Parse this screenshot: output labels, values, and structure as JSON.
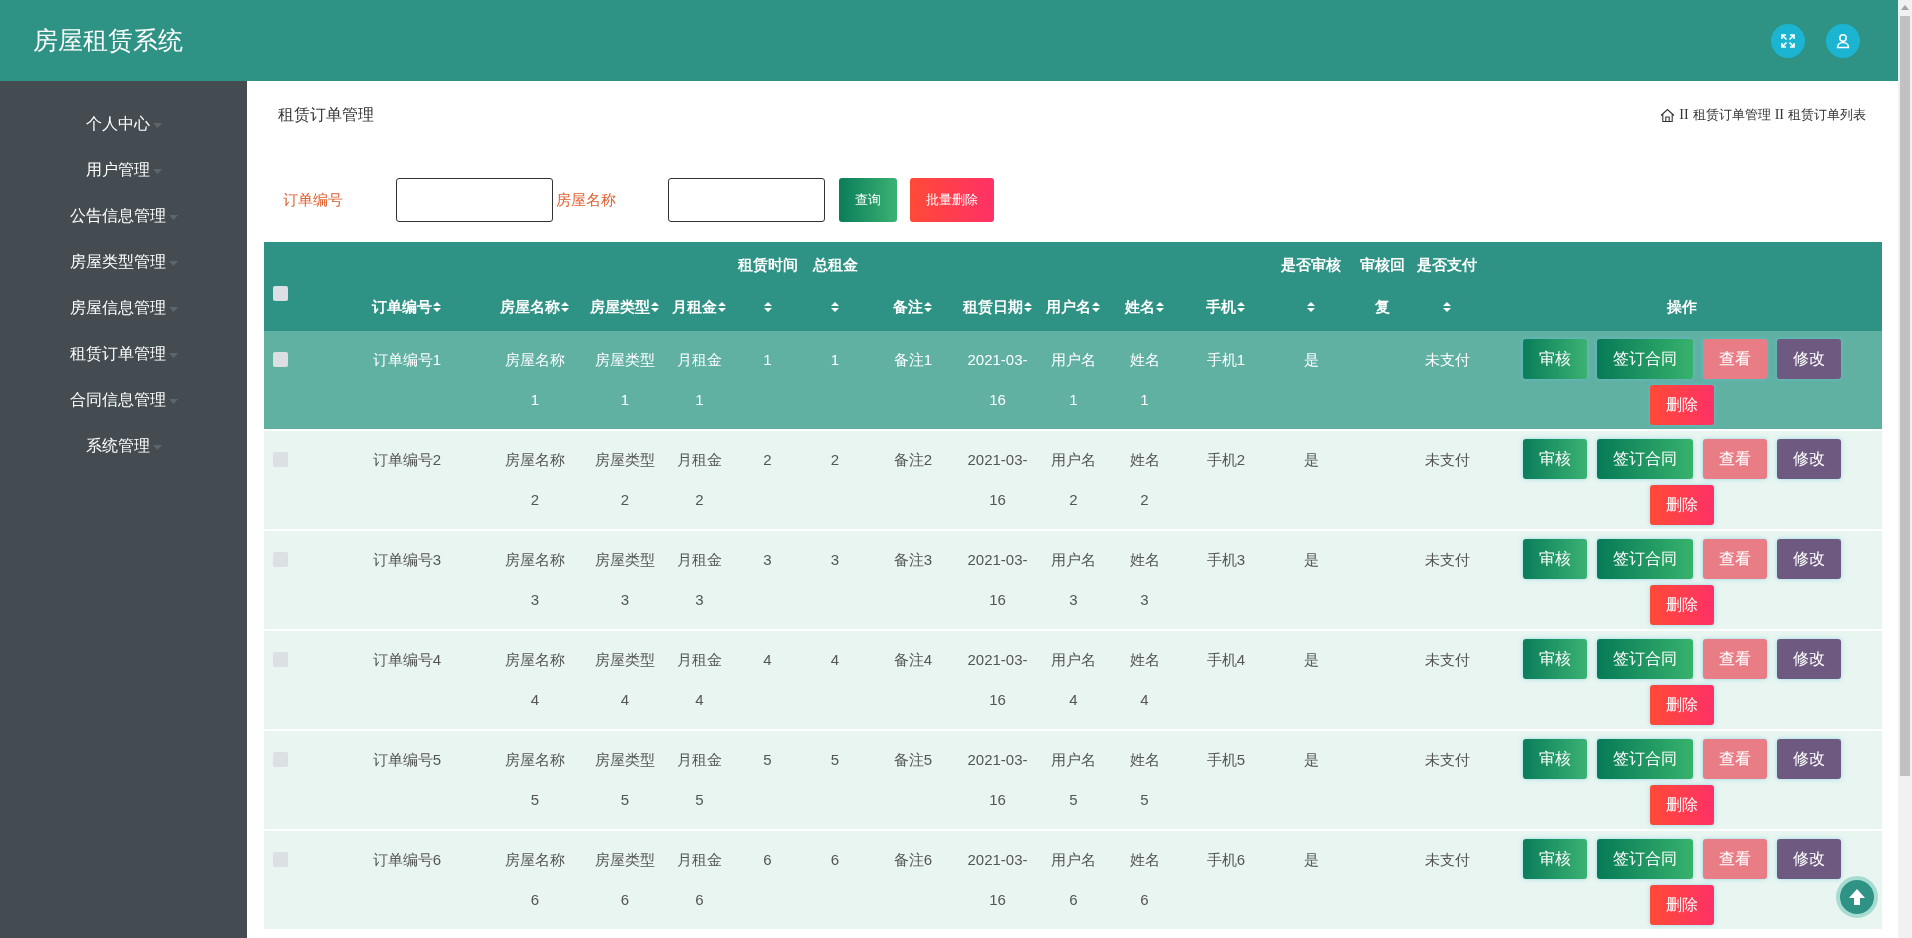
{
  "app": {
    "title": "房屋租赁系统"
  },
  "sidebar": {
    "items": [
      {
        "label": "个人中心"
      },
      {
        "label": "用户管理"
      },
      {
        "label": "公告信息管理"
      },
      {
        "label": "房屋类型管理"
      },
      {
        "label": "房屋信息管理"
      },
      {
        "label": "租赁订单管理"
      },
      {
        "label": "合同信息管理"
      },
      {
        "label": "系统管理"
      }
    ]
  },
  "page": {
    "title": "租赁订单管理",
    "breadcrumb": [
      {
        "kind": "separator",
        "text": "II"
      },
      {
        "kind": "item",
        "text": "租赁订单管理"
      },
      {
        "kind": "separator",
        "text": "II"
      },
      {
        "kind": "item",
        "text": "租赁订单列表"
      }
    ]
  },
  "search": {
    "fields": [
      {
        "label": "订单编号"
      },
      {
        "label": "房屋名称"
      }
    ],
    "buttons": [
      {
        "kind": "query",
        "label": "查询"
      },
      {
        "kind": "batch-delete",
        "label": "批量删除"
      }
    ]
  },
  "table": {
    "select_all": {
      "checked": false
    },
    "columns": [
      {
        "label": "订单编号",
        "sortable": true
      },
      {
        "label": "房屋名称",
        "sortable": true
      },
      {
        "label": "房屋类型",
        "sortable": true
      },
      {
        "label": "月租金",
        "sortable": true
      },
      {
        "label": "租赁时间",
        "sortable": true
      },
      {
        "label": "总租金",
        "sortable": true
      },
      {
        "label": "备注",
        "sortable": true
      },
      {
        "label": "租赁日期",
        "sortable": true
      },
      {
        "label": "用户名",
        "sortable": true
      },
      {
        "label": "姓名",
        "sortable": true
      },
      {
        "label": "手机",
        "sortable": true
      },
      {
        "label": "是否审核",
        "sortable": true
      },
      {
        "label": "审核回复",
        "sortable": false
      },
      {
        "label": "是否支付",
        "sortable": true
      },
      {
        "label": "操作",
        "sortable": false
      }
    ],
    "rows": [
      {
        "checked": false,
        "hovered": true,
        "cells": [
          "订单编号1",
          "房屋名称1",
          "房屋类型1",
          "月租金1",
          "1",
          "1",
          "备注1",
          "2021-03-16",
          "用户名1",
          "姓名1",
          "手机1",
          "是",
          null,
          "未支付"
        ],
        "actions": [
          {
            "kind": "approve",
            "label": "审核"
          },
          {
            "kind": "sign",
            "label": "签订合同"
          },
          {
            "kind": "view",
            "label": "查看"
          },
          {
            "kind": "edit",
            "label": "修改"
          },
          {
            "kind": "delete",
            "label": "删除"
          }
        ]
      },
      {
        "checked": false,
        "hovered": false,
        "cells": [
          "订单编号2",
          "房屋名称2",
          "房屋类型2",
          "月租金2",
          "2",
          "2",
          "备注2",
          "2021-03-16",
          "用户名2",
          "姓名2",
          "手机2",
          "是",
          null,
          "未支付"
        ],
        "actions": [
          {
            "kind": "approve",
            "label": "审核"
          },
          {
            "kind": "sign",
            "label": "签订合同"
          },
          {
            "kind": "view",
            "label": "查看"
          },
          {
            "kind": "edit",
            "label": "修改"
          },
          {
            "kind": "delete",
            "label": "删除"
          }
        ]
      },
      {
        "checked": false,
        "hovered": false,
        "cells": [
          "订单编号3",
          "房屋名称3",
          "房屋类型3",
          "月租金3",
          "3",
          "3",
          "备注3",
          "2021-03-16",
          "用户名3",
          "姓名3",
          "手机3",
          "是",
          null,
          "未支付"
        ],
        "actions": [
          {
            "kind": "approve",
            "label": "审核"
          },
          {
            "kind": "sign",
            "label": "签订合同"
          },
          {
            "kind": "view",
            "label": "查看"
          },
          {
            "kind": "edit",
            "label": "修改"
          },
          {
            "kind": "delete",
            "label": "删除"
          }
        ]
      },
      {
        "checked": false,
        "hovered": false,
        "cells": [
          "订单编号4",
          "房屋名称4",
          "房屋类型4",
          "月租金4",
          "4",
          "4",
          "备注4",
          "2021-03-16",
          "用户名4",
          "姓名4",
          "手机4",
          "是",
          null,
          "未支付"
        ],
        "actions": [
          {
            "kind": "approve",
            "label": "审核"
          },
          {
            "kind": "sign",
            "label": "签订合同"
          },
          {
            "kind": "view",
            "label": "查看"
          },
          {
            "kind": "edit",
            "label": "修改"
          },
          {
            "kind": "delete",
            "label": "删除"
          }
        ]
      },
      {
        "checked": false,
        "hovered": false,
        "cells": [
          "订单编号5",
          "房屋名称5",
          "房屋类型5",
          "月租金5",
          "5",
          "5",
          "备注5",
          "2021-03-16",
          "用户名5",
          "姓名5",
          "手机5",
          "是",
          null,
          "未支付"
        ],
        "actions": [
          {
            "kind": "approve",
            "label": "审核"
          },
          {
            "kind": "sign",
            "label": "签订合同"
          },
          {
            "kind": "view",
            "label": "查看"
          },
          {
            "kind": "edit",
            "label": "修改"
          },
          {
            "kind": "delete",
            "label": "删除"
          }
        ]
      },
      {
        "checked": false,
        "hovered": false,
        "cells": [
          "订单编号6",
          "房屋名称6",
          "房屋类型6",
          "月租金6",
          "6",
          "6",
          "备注6",
          "2021-03-16",
          "用户名6",
          "姓名6",
          "手机6",
          "是",
          null,
          "未支付"
        ],
        "actions": [
          {
            "kind": "approve",
            "label": "审核"
          },
          {
            "kind": "sign",
            "label": "签订合同"
          },
          {
            "kind": "view",
            "label": "查看"
          },
          {
            "kind": "edit",
            "label": "修改"
          },
          {
            "kind": "delete",
            "label": "删除"
          }
        ]
      }
    ]
  }
}
